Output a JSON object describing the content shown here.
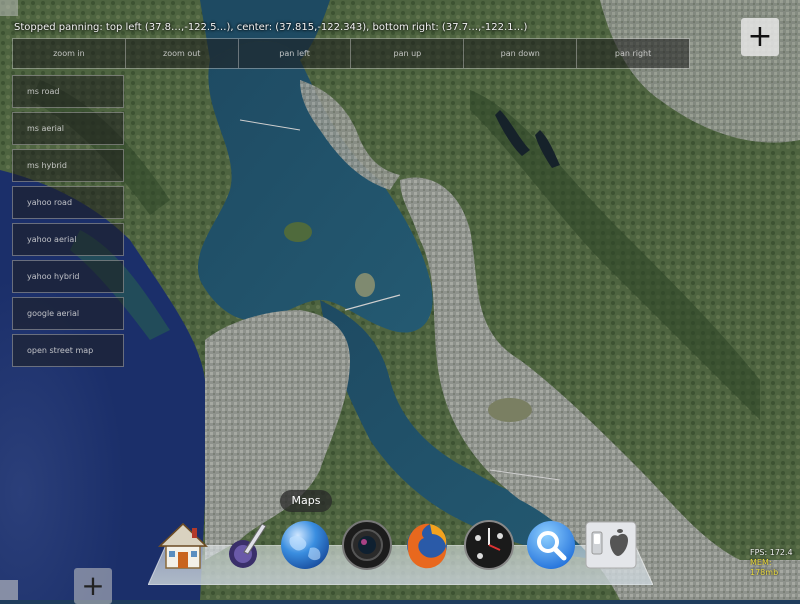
{
  "status": {
    "text": "Stopped panning: top left (37.8…,-122.5…), center: (37.815,-122.343), bottom right: (37.7…,-122.1…)"
  },
  "toolbar": {
    "buttons": [
      {
        "label": "zoom in"
      },
      {
        "label": "zoom out"
      },
      {
        "label": "pan left"
      },
      {
        "label": "pan up"
      },
      {
        "label": "pan down"
      },
      {
        "label": "pan right"
      }
    ]
  },
  "layers": {
    "buttons": [
      {
        "label": "ms road"
      },
      {
        "label": "ms aerial"
      },
      {
        "label": "ms hybrid"
      },
      {
        "label": "yahoo road"
      },
      {
        "label": "yahoo aerial"
      },
      {
        "label": "yahoo hybrid"
      },
      {
        "label": "google aerial"
      },
      {
        "label": "open street map"
      }
    ]
  },
  "controls": {
    "add_top_label": "+",
    "add_bottom_label": "+"
  },
  "dock": {
    "tooltip": "Maps",
    "icons": [
      "home-icon",
      "quill-icon",
      "globe-icon",
      "camera-icon",
      "firefox-icon",
      "clock-dashboard-icon",
      "spotlight-search-icon",
      "apple-switch-icon"
    ]
  },
  "stats": {
    "fps": "FPS: 172.4",
    "mem": "MEM: 178mb"
  },
  "colors": {
    "water": "#1f4d6e",
    "land": "#5b6b4a",
    "urban": "#9a9c96",
    "button_bg": "#1e1e1e"
  }
}
